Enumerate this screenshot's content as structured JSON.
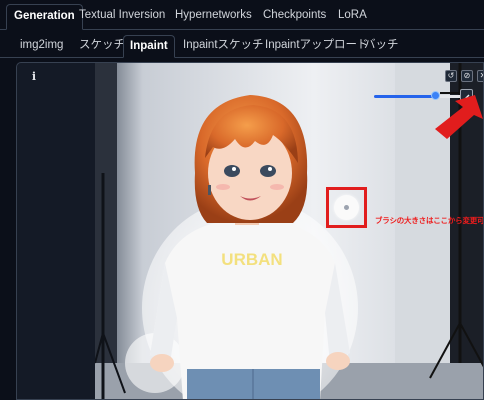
{
  "top_tabs": [
    "Generation",
    "Textual Inversion",
    "Hypernetworks",
    "Checkpoints",
    "LoRA"
  ],
  "top_tab_active": "Generation",
  "sub_tabs": [
    "img2img",
    "スケッチ",
    "Inpaint",
    "Inpaintスケッチ",
    "Inpaintアップロード",
    "バッチ"
  ],
  "sub_tab_active": "Inpaint",
  "panel": {
    "info_icon": "i",
    "image_print_text": "URBAN",
    "tools": [
      {
        "name": "undo-icon",
        "glyph": "↺"
      },
      {
        "name": "clear-icon",
        "glyph": "⊘"
      },
      {
        "name": "close-icon",
        "glyph": "✕"
      }
    ],
    "brush_size_fraction": 0.64,
    "brush_button_icon": "brush-icon"
  },
  "annotation": {
    "text": "ブラシの大きさはここから変更可",
    "color": "#ef1c1c"
  },
  "colors": {
    "accent": "#2563eb",
    "highlight": "#e11d1d",
    "background": "#0b0f19"
  }
}
